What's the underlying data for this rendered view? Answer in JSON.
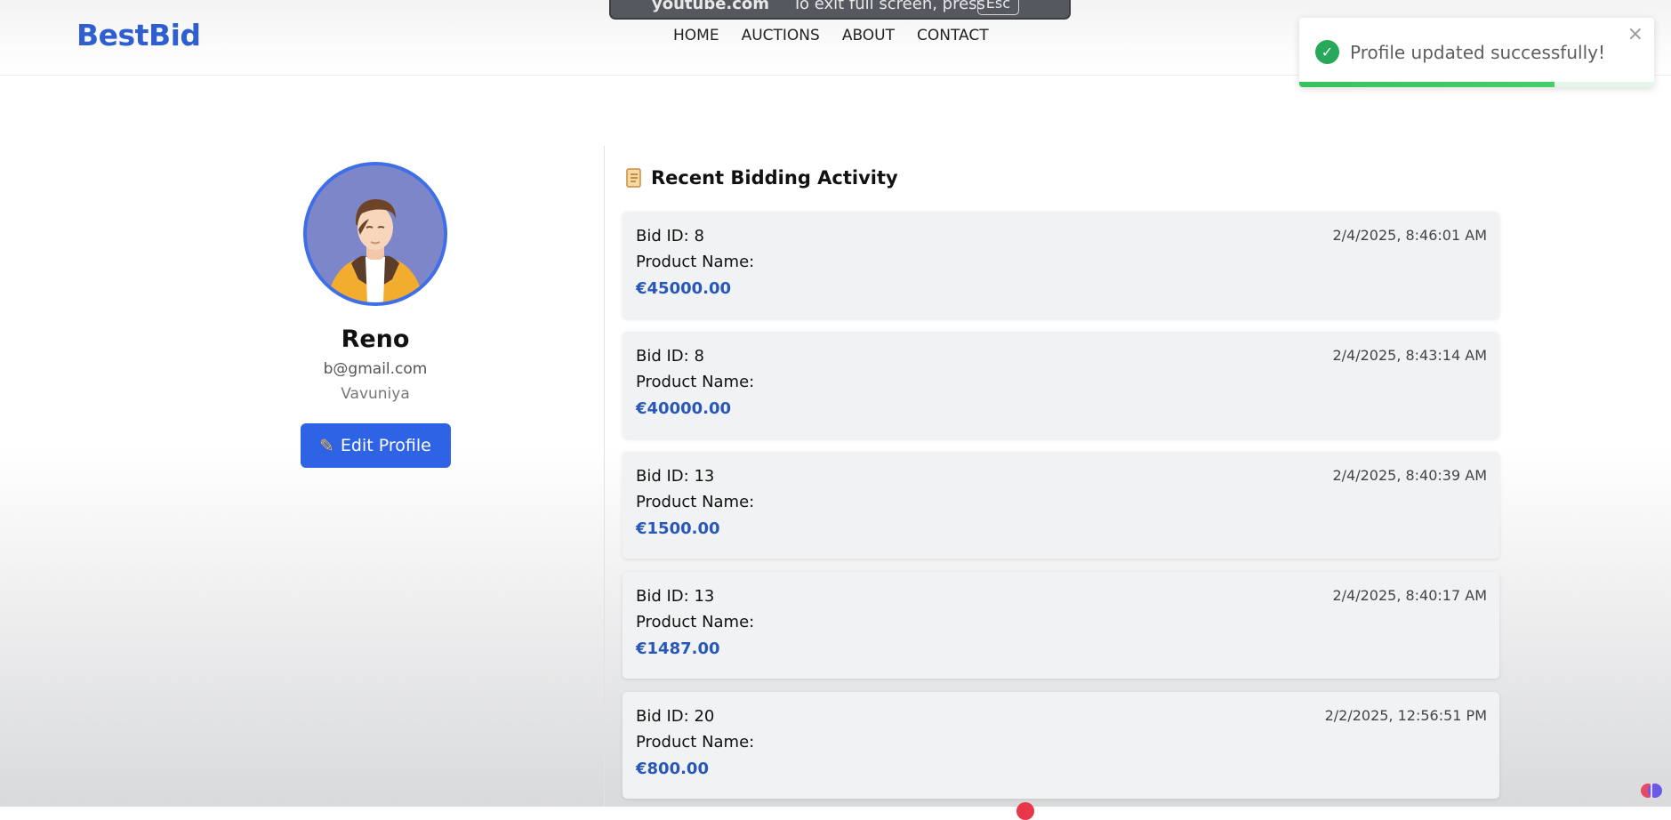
{
  "nav": {
    "brand": "BestBid",
    "links": [
      "HOME",
      "AUCTIONS",
      "ABOUT",
      "CONTACT"
    ]
  },
  "fullscreen_banner": {
    "site": "youtube.com",
    "message": "To exit full screen, press",
    "key": "Esc"
  },
  "toast": {
    "message": "Profile updated successfully!",
    "progress": 0.72,
    "accent": "#27a85b"
  },
  "profile": {
    "name": "Reno",
    "email": "b@gmail.com",
    "location": "Vavuniya",
    "edit_label": "Edit Profile"
  },
  "activity": {
    "title": "Recent Bidding Activity",
    "bids": [
      {
        "id_label": "Bid ID: 8",
        "product_label": "Product Name:",
        "amount": "€45000.00",
        "time": "2/4/2025, 8:46:01 AM"
      },
      {
        "id_label": "Bid ID: 8",
        "product_label": "Product Name:",
        "amount": "€40000.00",
        "time": "2/4/2025, 8:43:14 AM"
      },
      {
        "id_label": "Bid ID: 13",
        "product_label": "Product Name:",
        "amount": "€1500.00",
        "time": "2/4/2025, 8:40:39 AM"
      },
      {
        "id_label": "Bid ID: 13",
        "product_label": "Product Name:",
        "amount": "€1487.00",
        "time": "2/4/2025, 8:40:17 AM"
      },
      {
        "id_label": "Bid ID: 20",
        "product_label": "Product Name:",
        "amount": "€800.00",
        "time": "2/2/2025, 12:56:51 PM"
      }
    ]
  },
  "colors": {
    "brand": "#2f5fce",
    "button": "#2e63e6",
    "amount": "#2857b8",
    "avatar_ring": "#3e6fe6"
  }
}
